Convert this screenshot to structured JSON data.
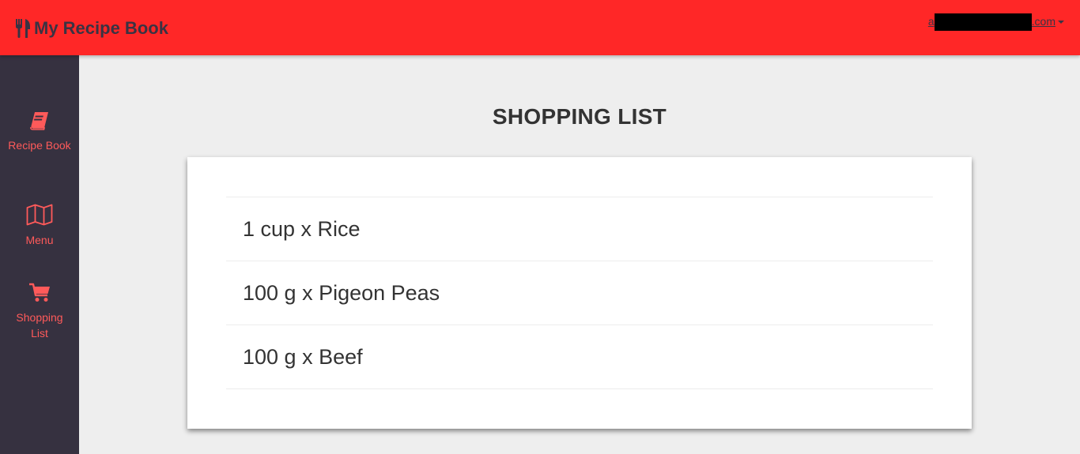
{
  "header": {
    "app_title": "My Recipe Book",
    "brand_icon": "utensils-icon",
    "account": {
      "email_prefix": "a",
      "email_suffix": ".com"
    }
  },
  "sidebar": {
    "items": [
      {
        "label": "Recipe Book",
        "icon": "book-icon"
      },
      {
        "label": "Menu",
        "icon": "map-icon"
      },
      {
        "label": "Shopping List",
        "icon": "cart-icon"
      }
    ]
  },
  "main": {
    "title": "SHOPPING LIST",
    "items": [
      {
        "text": "1 cup x Rice"
      },
      {
        "text": "100 g x Pigeon Peas"
      },
      {
        "text": "100 g x Beef"
      }
    ]
  },
  "colors": {
    "header_bg": "#ff2727",
    "sidebar_bg": "#363140",
    "accent": "#ff5a5a",
    "page_bg": "#eeeeee"
  }
}
